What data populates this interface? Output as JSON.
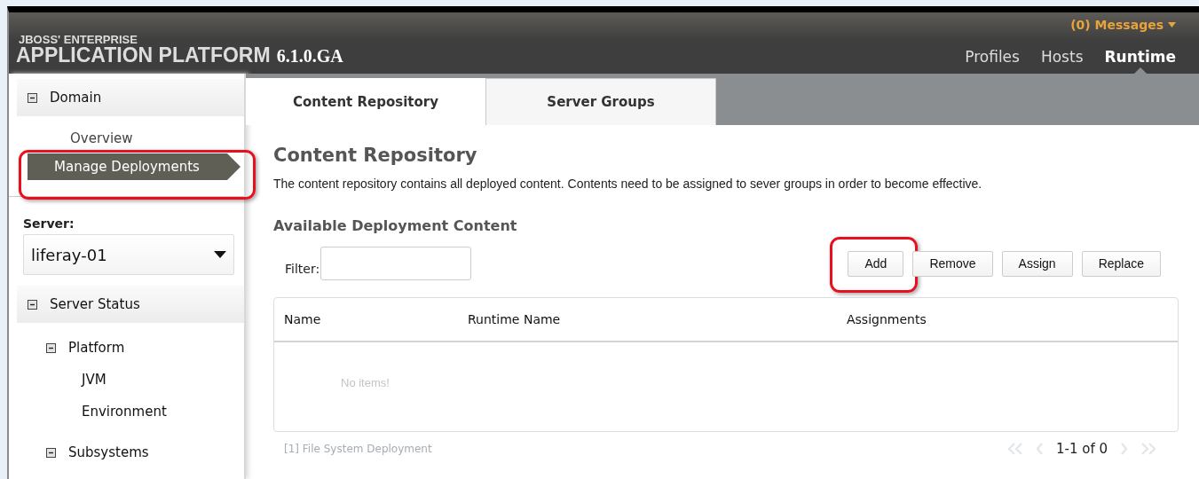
{
  "header": {
    "brand_top": "JBOSS' ENTERPRISE",
    "brand_main": "APPLICATION PLATFORM",
    "version": "6.1.0.GA",
    "messages": "(0) Messages",
    "nav": [
      {
        "label": "Profiles",
        "selected": false
      },
      {
        "label": "Hosts",
        "selected": false
      },
      {
        "label": "Runtime",
        "selected": true
      }
    ]
  },
  "sidebar": {
    "domain": {
      "label": "Domain",
      "expanded": true,
      "items": [
        {
          "label": "Overview",
          "selected": false,
          "annotated": false
        },
        {
          "label": "Manage Deployments",
          "selected": true,
          "annotated": true
        }
      ]
    },
    "server_label": "Server:",
    "server_select": "liferay-01",
    "tree": [
      {
        "label": "Server Status",
        "expanded": true,
        "children": [
          {
            "label": "Platform",
            "expanded": true,
            "children": [
              {
                "label": "JVM"
              },
              {
                "label": "Environment"
              }
            ]
          },
          {
            "label": "Subsystems",
            "expanded": true
          }
        ]
      }
    ]
  },
  "tabs": [
    {
      "label": "Content Repository",
      "selected": true
    },
    {
      "label": "Server Groups",
      "selected": false
    }
  ],
  "content": {
    "title": "Content Repository",
    "description": "The content repository contains all deployed content. Contents need to be assigned to sever groups in order to become effective.",
    "subtitle": "Available Deployment Content",
    "filter_label": "Filter:",
    "buttons": [
      {
        "label": "Add",
        "annotated": true
      },
      {
        "label": "Remove",
        "annotated": false
      },
      {
        "label": "Assign",
        "annotated": false
      },
      {
        "label": "Replace",
        "annotated": false
      }
    ],
    "table": {
      "columns": [
        "Name",
        "Runtime Name",
        "Assignments"
      ],
      "empty": "No items!"
    },
    "footer_link": "[1] File System Deployment",
    "pager": {
      "range": "1-1 of 0",
      "first_disabled": true,
      "prev_disabled": true,
      "next_disabled": true,
      "last_disabled": true
    }
  }
}
